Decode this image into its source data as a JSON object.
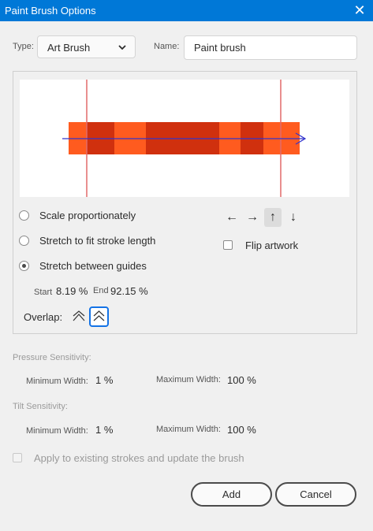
{
  "window": {
    "title": "Paint Brush Options",
    "close_icon": "close-icon"
  },
  "type": {
    "label": "Type:",
    "value": "Art Brush"
  },
  "name": {
    "label": "Name:",
    "value": "Paint brush"
  },
  "scale_options": {
    "scale_proportionately": "Scale proportionately",
    "stretch_to_fit": "Stretch to fit stroke length",
    "stretch_between_guides": "Stretch between guides",
    "selected": "stretch_between_guides"
  },
  "guides": {
    "start_label": "Start",
    "start_value": "8.19 %",
    "end_label": "End",
    "end_value": "92.15 %"
  },
  "direction": {
    "left": "←",
    "right": "→",
    "up": "↑",
    "down": "↓",
    "selected": "up"
  },
  "flip": {
    "label": "Flip artwork",
    "checked": false
  },
  "overlap": {
    "label": "Overlap:",
    "selected": "adjust-corner"
  },
  "pressure": {
    "heading": "Pressure Sensitivity:",
    "min_label": "Minimum Width:",
    "min_value": "1 %",
    "max_label": "Maximum Width:",
    "max_value": "100 %"
  },
  "tilt": {
    "heading": "Tilt Sensitivity:",
    "min_label": "Minimum Width:",
    "min_value": "1 %",
    "max_label": "Maximum Width:",
    "max_value": "100 %"
  },
  "apply": {
    "label": "Apply to existing strokes and update the brush",
    "checked": false
  },
  "buttons": {
    "add": "Add",
    "cancel": "Cancel"
  },
  "colors": {
    "titlebar": "#0078d7",
    "brush_light": "#ff5b1f",
    "brush_dark": "#d0300e",
    "guide_line": "#e26a6a",
    "direction_arrow": "#3333cc",
    "accent": "#1473e6"
  }
}
